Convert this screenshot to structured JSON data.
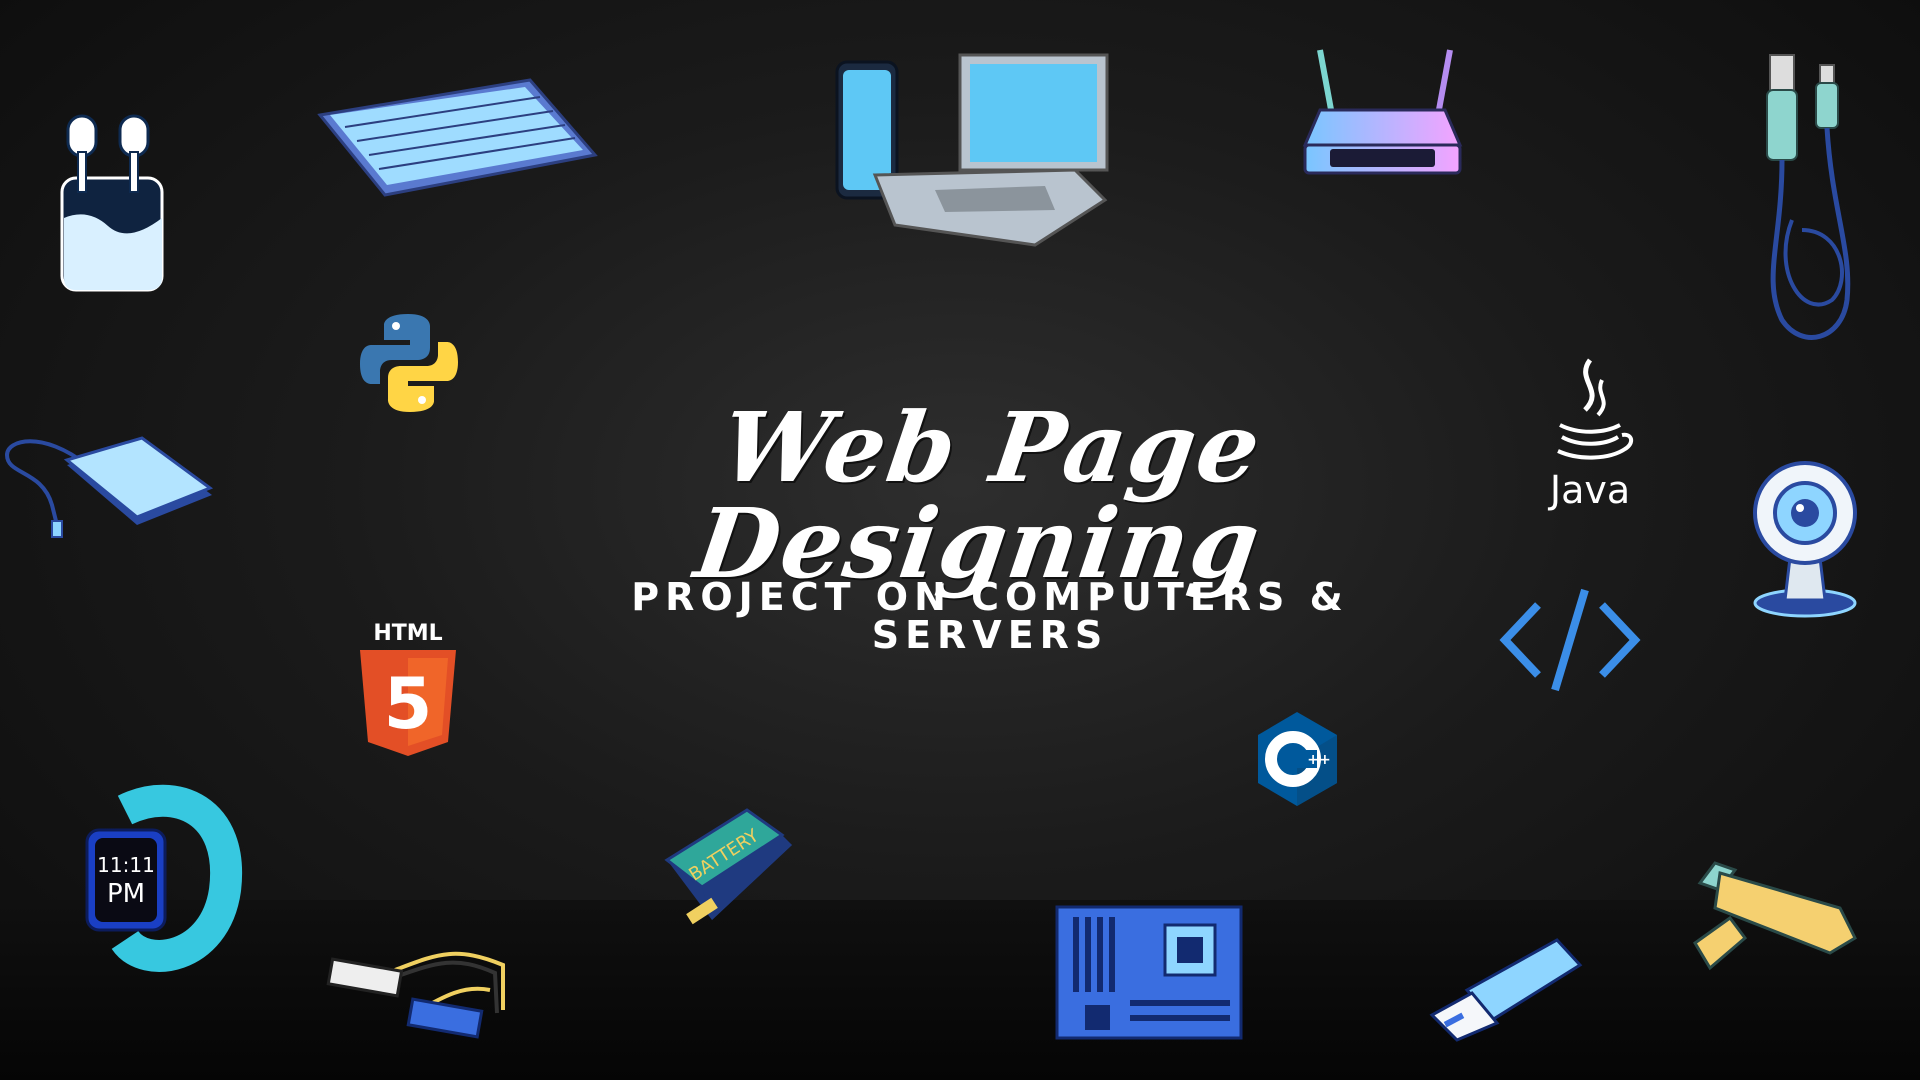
{
  "title": "Web Page Designing",
  "subtitle": "PROJECT ON COMPUTERS & SERVERS",
  "logos": {
    "html": "HTML",
    "html_number": "5",
    "java": "Java",
    "cpp": "C++",
    "battery": "BATTERY",
    "watch_time_hour": "11:11",
    "watch_time_period": "PM"
  },
  "icons": [
    "earbuds-icon",
    "keyboard-icon",
    "phone-laptop-icon",
    "router-icon",
    "usb-cable-icon",
    "python-icon",
    "external-drive-icon",
    "java-icon",
    "webcam-icon",
    "html5-icon",
    "code-brackets-icon",
    "cpp-icon",
    "smartwatch-icon",
    "battery-icon",
    "cable-connector-icon",
    "motherboard-icon",
    "usb-stick-icon",
    "usb-flash-drive-icon"
  ],
  "colors": {
    "background": "#1b1b1b",
    "accent_blue": "#5ec8f5",
    "text": "#ffffff"
  }
}
